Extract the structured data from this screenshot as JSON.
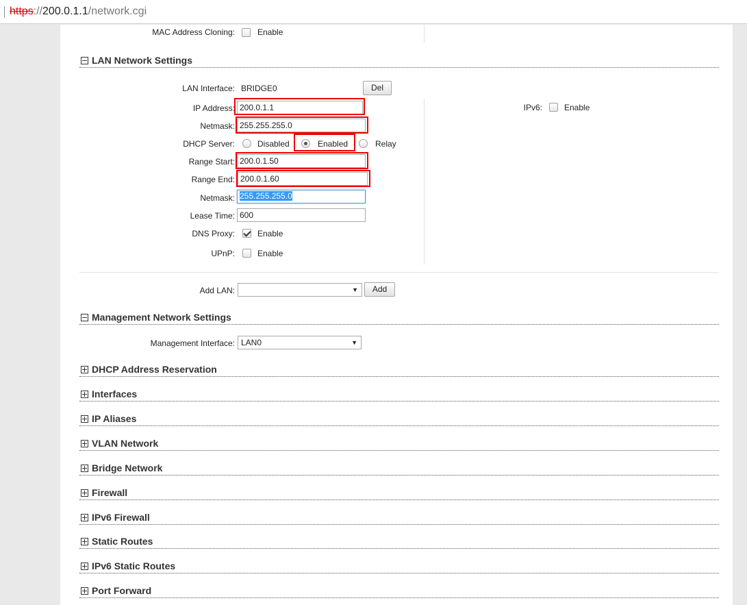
{
  "browser": {
    "url_scheme": "https",
    "url_sep": "://",
    "url_host": "200.0.1.1",
    "url_path": "/network.cgi"
  },
  "mac_cloning": {
    "label": "MAC Address Cloning:",
    "option": "Enable",
    "checked": false
  },
  "lan": {
    "title": "LAN Network Settings",
    "interface_label": "LAN Interface:",
    "interface_value": "BRIDGE0",
    "del_button": "Del",
    "ip_label": "IP Address:",
    "ip_value": "200.0.1.1",
    "netmask_label": "Netmask:",
    "netmask_value": "255.255.255.0",
    "dhcp_label": "DHCP Server:",
    "dhcp_options": [
      "Disabled",
      "Enabled",
      "Relay"
    ],
    "dhcp_selected": "Enabled",
    "range_start_label": "Range Start:",
    "range_start_value": "200.0.1.50",
    "range_end_label": "Range End:",
    "range_end_value": "200.0.1.60",
    "dhcp_netmask_label": "Netmask:",
    "dhcp_netmask_value": "255.255.255.0",
    "lease_label": "Lease Time:",
    "lease_value": "600",
    "dns_proxy_label": "DNS Proxy:",
    "dns_proxy_option": "Enable",
    "dns_proxy_checked": true,
    "upnp_label": "UPnP:",
    "upnp_option": "Enable",
    "upnp_checked": false,
    "ipv6_label": "IPv6:",
    "ipv6_option": "Enable",
    "ipv6_checked": false,
    "add_lan_label": "Add LAN:",
    "add_lan_value": "",
    "add_button": "Add"
  },
  "mgmt": {
    "title": "Management Network Settings",
    "interface_label": "Management Interface:",
    "interface_value": "LAN0"
  },
  "collapsed_sections": [
    "DHCP Address Reservation",
    "Interfaces",
    "IP Aliases",
    "VLAN Network",
    "Bridge Network",
    "Firewall",
    "IPv6 Firewall",
    "Static Routes",
    "IPv6 Static Routes",
    "Port Forward"
  ],
  "colors": {
    "highlight_box": "#e00000",
    "selection": "#3399ff",
    "page_bg": "#e9e9e9"
  }
}
